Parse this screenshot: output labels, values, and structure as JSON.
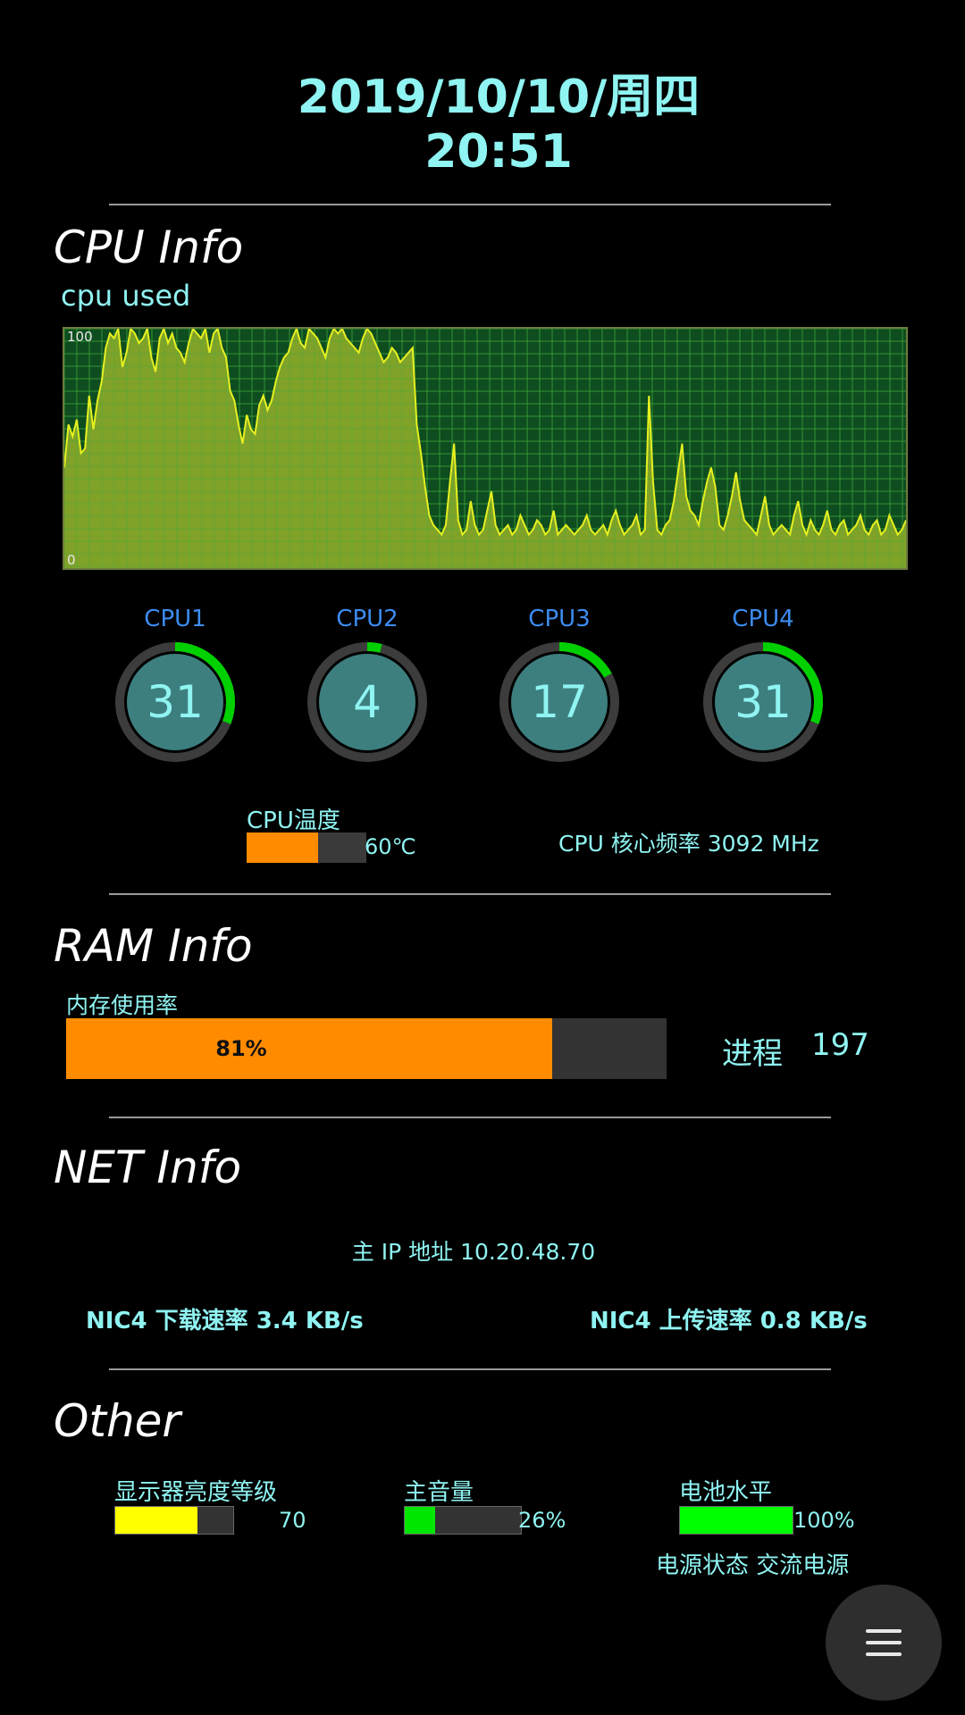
{
  "header": {
    "date": "2019/10/10/周四",
    "time": "20:51"
  },
  "cpu": {
    "title": "CPU Info",
    "graph_label": "cpu used",
    "graph_axis_max": "100",
    "graph_axis_min": "0",
    "graph_series": [
      42,
      60,
      55,
      62,
      48,
      50,
      72,
      58,
      70,
      78,
      92,
      98,
      96,
      100,
      84,
      90,
      100,
      98,
      94,
      96,
      100,
      88,
      82,
      96,
      100,
      94,
      98,
      92,
      90,
      86,
      94,
      100,
      98,
      96,
      100,
      90,
      98,
      100,
      92,
      88,
      74,
      70,
      60,
      52,
      64,
      58,
      56,
      68,
      72,
      66,
      70,
      78,
      84,
      88,
      90,
      96,
      100,
      94,
      92,
      100,
      98,
      96,
      92,
      88,
      96,
      100,
      98,
      100,
      96,
      94,
      92,
      90,
      96,
      100,
      98,
      94,
      90,
      86,
      88,
      92,
      90,
      86,
      88,
      90,
      92,
      60,
      48,
      34,
      22,
      18,
      16,
      14,
      18,
      36,
      52,
      20,
      14,
      16,
      28,
      18,
      14,
      16,
      24,
      32,
      18,
      14,
      16,
      18,
      14,
      16,
      22,
      18,
      14,
      16,
      20,
      18,
      14,
      16,
      24,
      14,
      16,
      18,
      16,
      14,
      16,
      18,
      22,
      16,
      14,
      16,
      18,
      14,
      20,
      24,
      18,
      14,
      16,
      18,
      22,
      14,
      16,
      72,
      36,
      16,
      14,
      18,
      20,
      28,
      40,
      52,
      30,
      24,
      22,
      18,
      28,
      36,
      42,
      34,
      18,
      16,
      22,
      30,
      40,
      28,
      20,
      18,
      16,
      14,
      22,
      30,
      18,
      14,
      16,
      18,
      16,
      14,
      22,
      28,
      18,
      14,
      20,
      16,
      14,
      18,
      24,
      16,
      14,
      18,
      20,
      14,
      16,
      18,
      22,
      16,
      14,
      18,
      20,
      14,
      16,
      22,
      18,
      14,
      16,
      20
    ],
    "cores": [
      {
        "label": "CPU1",
        "value": "31",
        "pct": 31
      },
      {
        "label": "CPU2",
        "value": "4",
        "pct": 4
      },
      {
        "label": "CPU3",
        "value": "17",
        "pct": 17
      },
      {
        "label": "CPU4",
        "value": "31",
        "pct": 31
      }
    ],
    "temp_label": "CPU温度",
    "temp_value": "60℃",
    "temp_fraction": 0.6,
    "freq_text": "CPU 核心频率 3092 MHz"
  },
  "ram": {
    "title": "RAM Info",
    "usage_label": "内存使用率",
    "usage_pct_text": "81%",
    "usage_fraction": 0.81,
    "process_label": "进程",
    "process_count": "197"
  },
  "net": {
    "title": "NET Info",
    "ip_text": "主 IP 地址 10.20.48.70",
    "download_text": "NIC4 下载速率 3.4 KB/s",
    "upload_text": "NIC4 上传速率 0.8 KB/s"
  },
  "other": {
    "title": "Other",
    "brightness_label": "显示器亮度等级",
    "brightness_value": "70",
    "brightness_fraction": 0.7,
    "volume_label": "主音量",
    "volume_value": "26%",
    "volume_fraction": 0.26,
    "battery_label": "电池水平",
    "battery_value": "100%",
    "battery_fraction": 1.0,
    "power_text": "电源状态 交流电源"
  },
  "colors": {
    "accent": "#8ff4f2",
    "cpu_label": "#3d8cf0",
    "orange": "#ff8c00",
    "green": "#00e600",
    "yellow": "#ffff00",
    "graph_bg": "#0e4d1f",
    "graph_fill": "#9ab52b",
    "graph_line": "#e6f020"
  },
  "menu_button": {
    "icon": "hamburger-menu-icon"
  }
}
